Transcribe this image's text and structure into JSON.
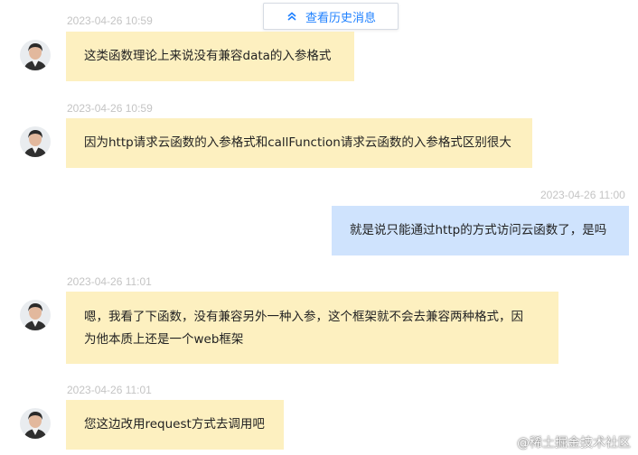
{
  "header": {
    "history_label": "查看历史消息",
    "history_icon": "double-chevron-up-icon"
  },
  "colors": {
    "accent": "#1e80ff",
    "left_bubble": "#fdf0c0",
    "right_bubble": "#cfe3fd",
    "timestamp": "#c4c4c4"
  },
  "messages": [
    {
      "time": "2023-04-26 10:59",
      "side": "left",
      "text": "这类函数理论上来说没有兼容data的入参格式"
    },
    {
      "time": "2023-04-26 10:59",
      "side": "left",
      "text": "因为http请求云函数的入参格式和callFunction请求云函数的入参格式区别很大"
    },
    {
      "time": "2023-04-26 11:00",
      "side": "right",
      "text": "就是说只能通过http的方式访问云函数了，是吗"
    },
    {
      "time": "2023-04-26 11:01",
      "side": "left",
      "text": "嗯，我看了下函数，没有兼容另外一种入参，这个框架就不会去兼容两种格式，因为他本质上还是一个web框架"
    },
    {
      "time": "2023-04-26 11:01",
      "side": "left",
      "text": "您这边改用request方式去调用吧"
    }
  ],
  "watermark": "@稀土掘金技术社区"
}
